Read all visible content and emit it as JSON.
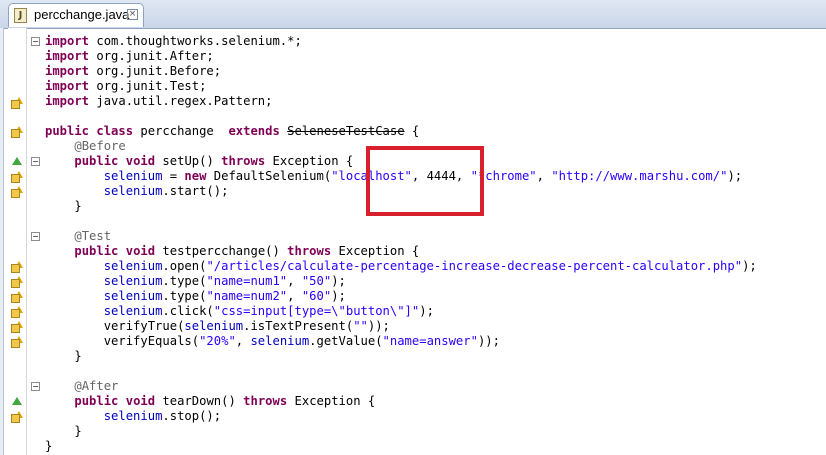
{
  "editor": {
    "tab_label": "percchange.java",
    "tab_icon": "java-file-icon",
    "close_icon": "close-icon",
    "colors": {
      "keyword": "#7f0055",
      "string": "#2a00ff",
      "field": "#0000c0",
      "annotation": "#646464",
      "highlight": "#d8202c"
    }
  },
  "code": {
    "l1": [
      "import",
      " com.thoughtworks.selenium.*;"
    ],
    "l2": [
      "import",
      " org.junit.After;"
    ],
    "l3": [
      "import",
      " org.junit.Before;"
    ],
    "l4": [
      "import",
      " org.junit.Test;"
    ],
    "l5": [
      "import",
      " java.util.regex.Pattern;"
    ],
    "l7": [
      "public",
      " ",
      "class",
      " percchange  ",
      "extends",
      " ",
      "SeleneseTestCase",
      " {"
    ],
    "l8": [
      "    ",
      "@Before"
    ],
    "l9": [
      "    ",
      "public",
      " ",
      "void",
      " setUp() ",
      "throws",
      " Exception {"
    ],
    "l10": [
      "        ",
      "selenium",
      " = ",
      "new",
      " DefaultSelenium(",
      "\"localhost\"",
      ", 4444, ",
      "\"*chrome\"",
      ", ",
      "\"http://www.marshu.com/\"",
      ");"
    ],
    "l11": [
      "        ",
      "selenium",
      ".start();"
    ],
    "l12": [
      "    }"
    ],
    "l14": [
      "    ",
      "@Test"
    ],
    "l15": [
      "    ",
      "public",
      " ",
      "void",
      " testpercchange() ",
      "throws",
      " Exception {"
    ],
    "l16": [
      "        ",
      "selenium",
      ".open(",
      "\"/articles/calculate-percentage-increase-decrease-percent-calculator.php\"",
      ");"
    ],
    "l17": [
      "        ",
      "selenium",
      ".type(",
      "\"name=num1\"",
      ", ",
      "\"50\"",
      ");"
    ],
    "l18": [
      "        ",
      "selenium",
      ".type(",
      "\"name=num2\"",
      ", ",
      "\"60\"",
      ");"
    ],
    "l19": [
      "        ",
      "selenium",
      ".click(",
      "\"css=input[type=\\\"button\\\"]\"",
      ");"
    ],
    "l20": [
      "        verifyTrue(",
      "selenium",
      ".isTextPresent(",
      "\"\"",
      "));"
    ],
    "l21": [
      "        verifyEquals(",
      "\"20%\"",
      ", ",
      "selenium",
      ".getValue(",
      "\"name=answer\"",
      "));"
    ],
    "l22": [
      "    }"
    ],
    "l24": [
      "    ",
      "@After"
    ],
    "l25": [
      "    ",
      "public",
      " ",
      "void",
      " tearDown() ",
      "throws",
      " Exception {"
    ],
    "l26": [
      "        ",
      "selenium",
      ".stop();"
    ],
    "l27": [
      "    }"
    ],
    "l28": [
      "}"
    ]
  }
}
